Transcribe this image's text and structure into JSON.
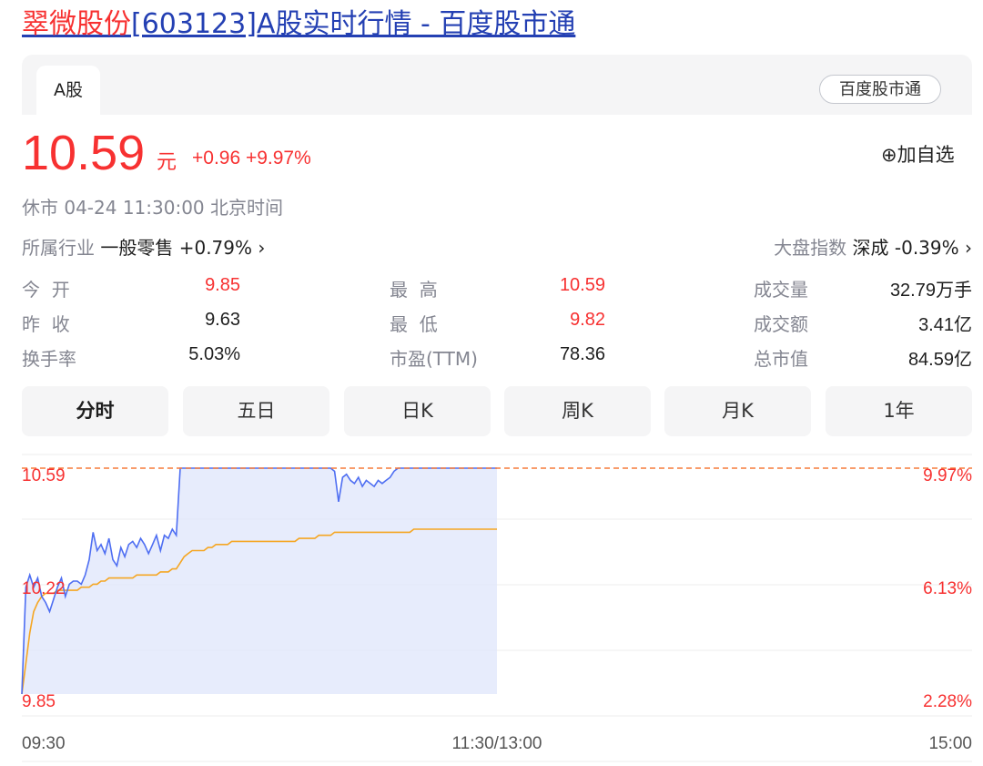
{
  "title": {
    "name": "翠微股份",
    "rest": "[603123]A股实时行情 - 百度股市通"
  },
  "tab_label": "A股",
  "source_badge": "百度股市通",
  "price": "10.59",
  "price_unit": "元",
  "change": "+0.96 +9.97%",
  "watchlist_label": "⊕加自选",
  "status": "休市  04-24 11:30:00  北京时间",
  "industry": {
    "label": "所属行业",
    "value": "一般零售 +0.79% ›"
  },
  "index": {
    "label": "大盘指数",
    "value": "深成 -0.39% ›"
  },
  "stats": [
    {
      "label": "今  开",
      "value": "9.85",
      "color": "red"
    },
    {
      "label": "最  高",
      "value": "10.59",
      "color": "red"
    },
    {
      "label": "成交量",
      "value": "32.79万手",
      "color": "black"
    },
    {
      "label": "昨  收",
      "value": "9.63",
      "color": "black"
    },
    {
      "label": "最  低",
      "value": "9.82",
      "color": "red"
    },
    {
      "label": "成交额",
      "value": "3.41亿",
      "color": "black"
    },
    {
      "label": "换手率",
      "value": "5.03%",
      "color": "black"
    },
    {
      "label": "市盈(TTM)",
      "value": "78.36",
      "color": "black"
    },
    {
      "label": "总市值",
      "value": "84.59亿",
      "color": "black"
    }
  ],
  "period_tabs": [
    "分时",
    "五日",
    "日K",
    "周K",
    "月K",
    "1年"
  ],
  "colors": {
    "up": "#f73131",
    "line": "#4e6ef2",
    "avg": "#f5a623",
    "fill": "#dfe5fb"
  },
  "chart_data": {
    "type": "line",
    "y_left_ticks": [
      "10.59",
      "10.22",
      "9.85"
    ],
    "y_right_ticks": [
      "9.97%",
      "6.13%",
      "2.28%"
    ],
    "x_ticks": [
      "09:30",
      "11:30/13:00",
      "15:00"
    ],
    "ylim": [
      9.85,
      10.59
    ],
    "limit_line": 10.59,
    "series": [
      {
        "values": [
          9.85,
          10.2,
          10.24,
          10.2,
          10.23,
          10.17,
          10.15,
          10.12,
          10.16,
          10.2,
          10.23,
          10.17,
          10.21,
          10.22,
          10.22,
          10.21,
          10.24,
          10.29,
          10.38,
          10.32,
          10.34,
          10.31,
          10.36,
          10.29,
          10.27,
          10.33,
          10.3,
          10.34,
          10.35,
          10.33,
          10.36,
          10.34,
          10.31,
          10.34,
          10.37,
          10.32,
          10.37,
          10.36,
          10.39,
          10.37,
          10.59,
          10.59,
          10.59,
          10.59,
          10.59,
          10.59,
          10.59,
          10.59,
          10.59,
          10.59,
          10.59,
          10.59,
          10.59,
          10.59,
          10.59,
          10.59,
          10.59,
          10.59,
          10.59,
          10.59,
          10.59,
          10.59,
          10.59,
          10.59,
          10.59,
          10.59,
          10.59,
          10.59,
          10.59,
          10.59,
          10.59,
          10.59,
          10.59,
          10.59,
          10.59,
          10.59,
          10.59,
          10.59,
          10.59,
          10.58,
          10.48,
          10.56,
          10.57,
          10.55,
          10.54,
          10.56,
          10.53,
          10.55,
          10.54,
          10.53,
          10.55,
          10.54,
          10.55,
          10.56,
          10.58,
          10.59,
          10.59,
          10.59,
          10.59,
          10.59,
          10.59,
          10.59,
          10.59,
          10.59,
          10.59,
          10.59,
          10.59,
          10.59,
          10.59,
          10.59,
          10.59,
          10.59,
          10.59,
          10.59,
          10.59,
          10.59,
          10.59,
          10.59,
          10.59,
          10.59,
          10.59
        ]
      },
      {
        "values": [
          9.85,
          9.95,
          10.05,
          10.12,
          10.15,
          10.17,
          10.18,
          10.18,
          10.18,
          10.19,
          10.19,
          10.19,
          10.19,
          10.19,
          10.19,
          10.2,
          10.2,
          10.2,
          10.21,
          10.21,
          10.22,
          10.22,
          10.23,
          10.23,
          10.23,
          10.23,
          10.23,
          10.23,
          10.23,
          10.24,
          10.24,
          10.24,
          10.24,
          10.24,
          10.24,
          10.25,
          10.25,
          10.25,
          10.26,
          10.26,
          10.28,
          10.3,
          10.31,
          10.32,
          10.32,
          10.32,
          10.32,
          10.33,
          10.33,
          10.34,
          10.34,
          10.34,
          10.34,
          10.35,
          10.35,
          10.35,
          10.35,
          10.35,
          10.35,
          10.35,
          10.35,
          10.35,
          10.35,
          10.35,
          10.35,
          10.35,
          10.35,
          10.35,
          10.35,
          10.35,
          10.36,
          10.36,
          10.36,
          10.36,
          10.36,
          10.37,
          10.37,
          10.37,
          10.37,
          10.38,
          10.38,
          10.38,
          10.38,
          10.38,
          10.38,
          10.38,
          10.38,
          10.38,
          10.38,
          10.38,
          10.38,
          10.38,
          10.38,
          10.38,
          10.38,
          10.38,
          10.38,
          10.38,
          10.38,
          10.39,
          10.39,
          10.39,
          10.39,
          10.39,
          10.39,
          10.39,
          10.39,
          10.39,
          10.39,
          10.39,
          10.39,
          10.39,
          10.39,
          10.39,
          10.39,
          10.39,
          10.39,
          10.39,
          10.39,
          10.39,
          10.39
        ]
      }
    ]
  }
}
